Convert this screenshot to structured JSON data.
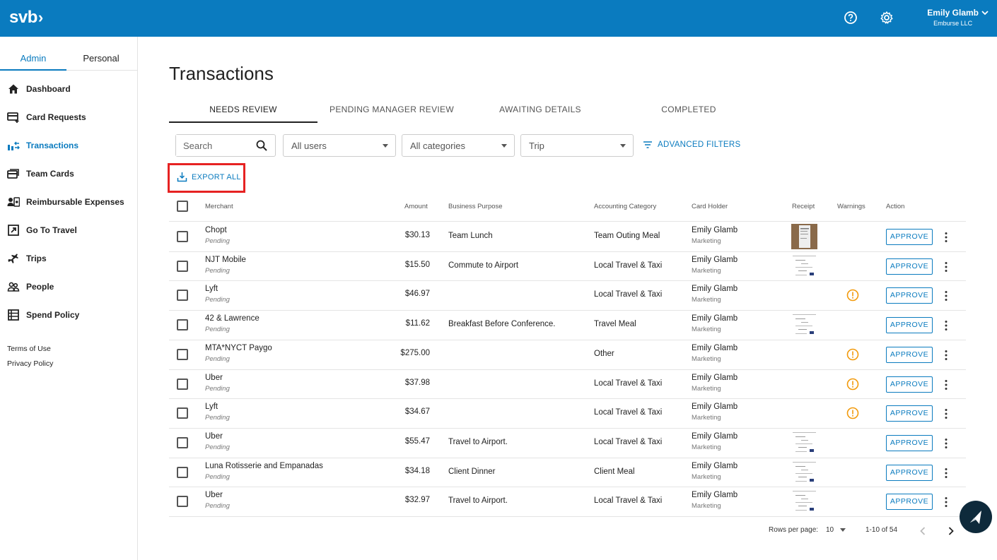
{
  "app": {
    "logo": "svb",
    "user_name": "Emily Glamb",
    "user_org": "Emburse LLC"
  },
  "icons": {
    "help": "help-circle-icon",
    "settings": "gear-icon",
    "user_menu": "chevron-down-icon"
  },
  "colors": {
    "brand": "#0a7bbf",
    "highlight": "#e62222",
    "warning": "#f29a0c"
  },
  "sidebar": {
    "tabs": [
      {
        "label": "Admin",
        "active": true
      },
      {
        "label": "Personal",
        "active": false
      }
    ],
    "items": [
      {
        "label": "Dashboard",
        "icon": "home-icon"
      },
      {
        "label": "Card Requests",
        "icon": "card-plus-icon"
      },
      {
        "label": "Transactions",
        "icon": "transactions-icon",
        "active": true
      },
      {
        "label": "Team Cards",
        "icon": "cards-icon"
      },
      {
        "label": "Reimbursable Expenses",
        "icon": "reimburse-icon"
      },
      {
        "label": "Go To Travel",
        "icon": "external-link-icon"
      },
      {
        "label": "Trips",
        "icon": "airplane-icon"
      },
      {
        "label": "People",
        "icon": "people-icon"
      },
      {
        "label": "Spend Policy",
        "icon": "policy-icon"
      }
    ],
    "footer": {
      "terms": "Terms of Use",
      "privacy": "Privacy Policy"
    }
  },
  "main": {
    "title": "Transactions",
    "tabs": [
      {
        "label": "NEEDS REVIEW",
        "active": true
      },
      {
        "label": "PENDING MANAGER REVIEW"
      },
      {
        "label": "AWAITING DETAILS"
      },
      {
        "label": "COMPLETED"
      }
    ],
    "filters": {
      "search_placeholder": "Search",
      "users": "All users",
      "categories": "All categories",
      "trip": "Trip",
      "advanced": "ADVANCED FILTERS"
    },
    "export_label": "EXPORT ALL",
    "columns": {
      "merchant": "Merchant",
      "amount": "Amount",
      "purpose": "Business Purpose",
      "category": "Accounting Category",
      "holder": "Card Holder",
      "receipt": "Receipt",
      "warnings": "Warnings",
      "action": "Action"
    },
    "approve_label": "APPROVE",
    "rows": [
      {
        "merchant": "Chopt",
        "status": "Pending",
        "amount": "$30.13",
        "purpose": "Team Lunch",
        "category": "Team Outing Meal",
        "holder": "Emily Glamb",
        "dept": "Marketing",
        "receipt": "photo",
        "warning": false
      },
      {
        "merchant": "NJT Mobile",
        "status": "Pending",
        "amount": "$15.50",
        "purpose": "Commute to Airport",
        "category": "Local Travel & Taxi",
        "holder": "Emily Glamb",
        "dept": "Marketing",
        "receipt": "doc",
        "warning": false
      },
      {
        "merchant": "Lyft",
        "status": "Pending",
        "amount": "$46.97",
        "purpose": "",
        "category": "Local Travel & Taxi",
        "holder": "Emily Glamb",
        "dept": "Marketing",
        "receipt": "",
        "warning": true
      },
      {
        "merchant": "42 & Lawrence",
        "status": "Pending",
        "amount": "$11.62",
        "purpose": "Breakfast Before Conference.",
        "category": "Travel Meal",
        "holder": "Emily Glamb",
        "dept": "Marketing",
        "receipt": "doc",
        "warning": false
      },
      {
        "merchant": "MTA*NYCT Paygo",
        "status": "Pending",
        "amount": "$275.00",
        "purpose": "",
        "category": "Other",
        "holder": "Emily Glamb",
        "dept": "Marketing",
        "receipt": "",
        "warning": true
      },
      {
        "merchant": "Uber",
        "status": "Pending",
        "amount": "$37.98",
        "purpose": "",
        "category": "Local Travel & Taxi",
        "holder": "Emily Glamb",
        "dept": "Marketing",
        "receipt": "",
        "warning": true
      },
      {
        "merchant": "Lyft",
        "status": "Pending",
        "amount": "$34.67",
        "purpose": "",
        "category": "Local Travel & Taxi",
        "holder": "Emily Glamb",
        "dept": "Marketing",
        "receipt": "",
        "warning": true
      },
      {
        "merchant": "Uber",
        "status": "Pending",
        "amount": "$55.47",
        "purpose": "Travel to Airport.",
        "category": "Local Travel & Taxi",
        "holder": "Emily Glamb",
        "dept": "Marketing",
        "receipt": "doc",
        "warning": false
      },
      {
        "merchant": "Luna Rotisserie and Empanadas",
        "status": "Pending",
        "amount": "$34.18",
        "purpose": "Client Dinner",
        "category": "Client Meal",
        "holder": "Emily Glamb",
        "dept": "Marketing",
        "receipt": "doc",
        "warning": false
      },
      {
        "merchant": "Uber",
        "status": "Pending",
        "amount": "$32.97",
        "purpose": "Travel to Airport.",
        "category": "Local Travel & Taxi",
        "holder": "Emily Glamb",
        "dept": "Marketing",
        "receipt": "doc",
        "warning": false
      }
    ],
    "pagination": {
      "rows_per_page_label": "Rows per page:",
      "rows_per_page": "10",
      "range": "1-10 of 54"
    }
  }
}
